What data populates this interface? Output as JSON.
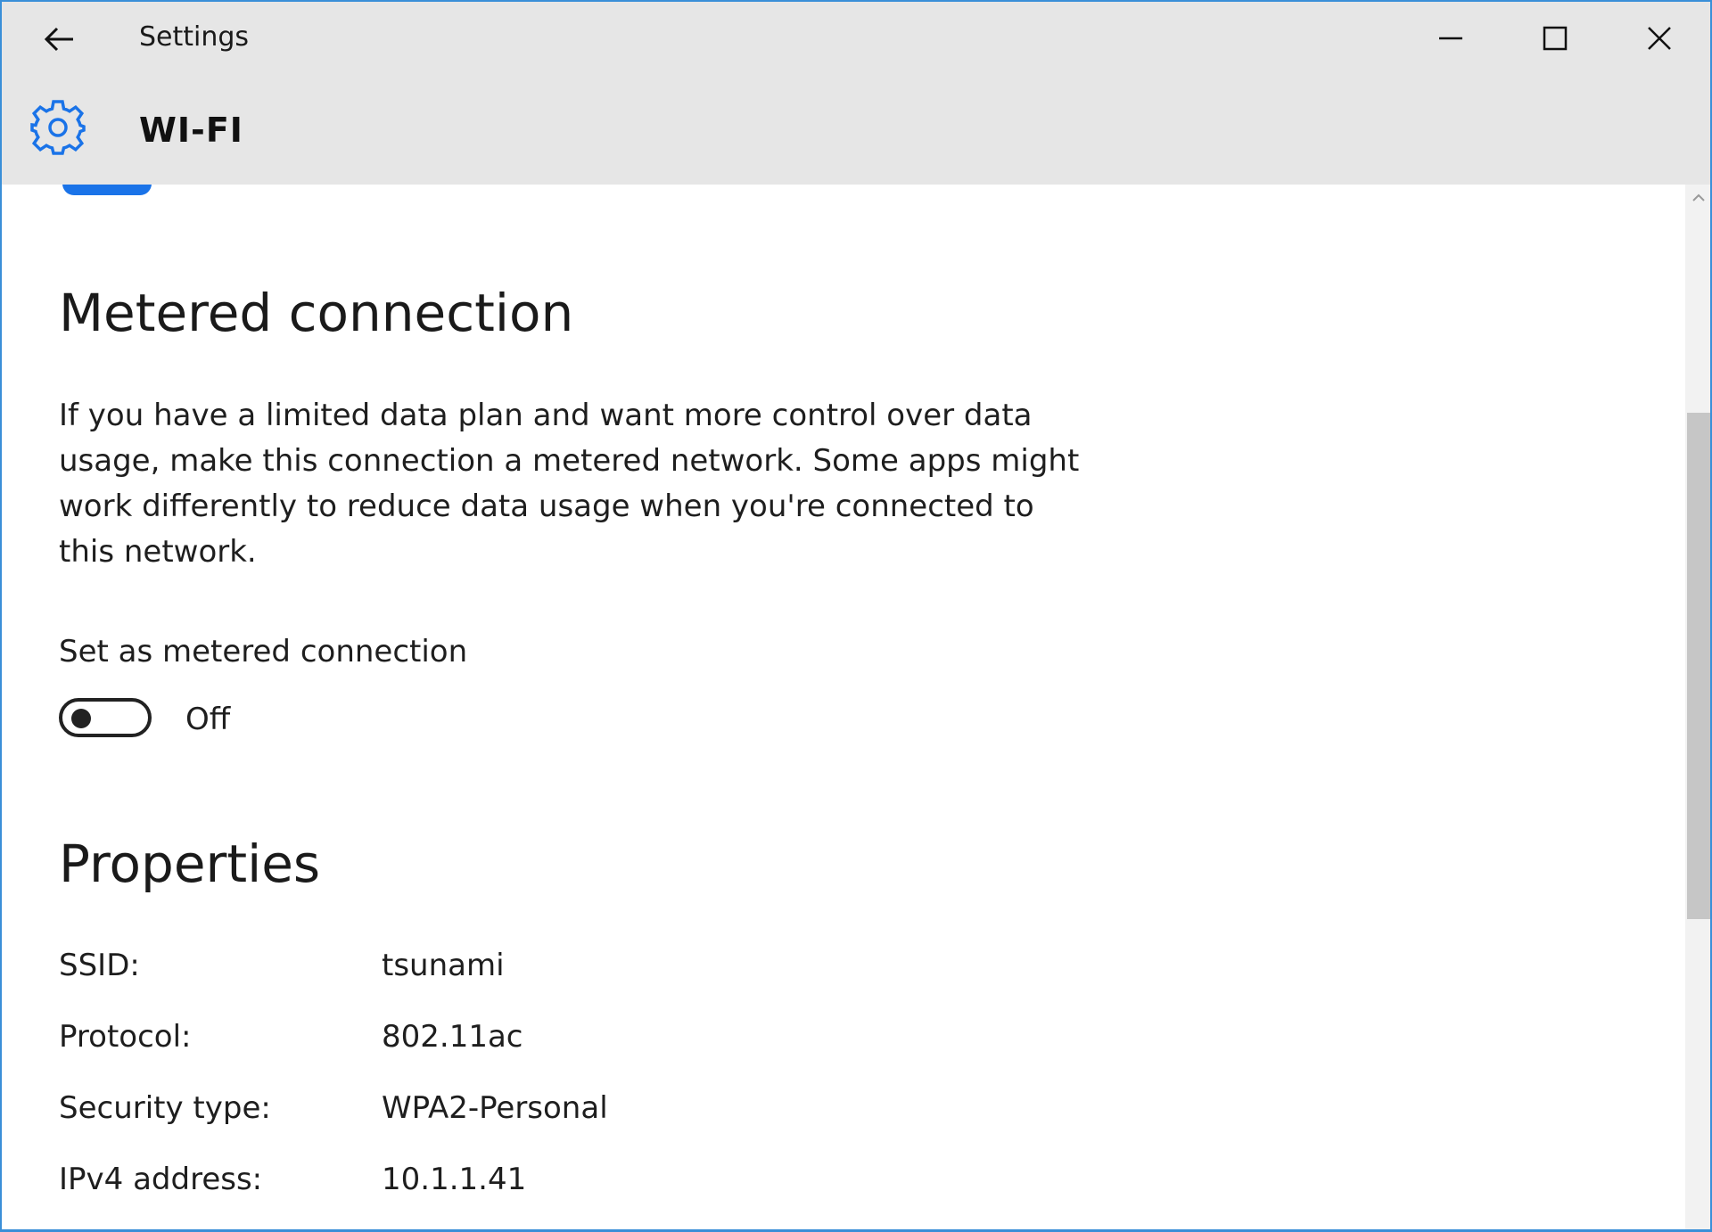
{
  "window": {
    "app_title": "Settings",
    "controls": {
      "minimize_icon": "minimize-icon",
      "maximize_icon": "maximize-icon",
      "close_icon": "close-icon"
    }
  },
  "header": {
    "icon": "gear-icon",
    "title": "WI-FI",
    "accent_color": "#1a73e8"
  },
  "metered": {
    "title": "Metered connection",
    "description": "If you have a limited data plan and want more control over data usage, make this connection a metered network. Some apps might work differently to reduce data usage when you're connected to this network.",
    "toggle_label": "Set as metered connection",
    "toggle_state": "Off",
    "toggle_on": false
  },
  "properties": {
    "title": "Properties",
    "rows": [
      {
        "key": "SSID:",
        "value": "tsunami"
      },
      {
        "key": "Protocol:",
        "value": "802.11ac"
      },
      {
        "key": "Security type:",
        "value": "WPA2-Personal"
      },
      {
        "key": "IPv4 address:",
        "value": "10.1.1.41"
      }
    ]
  }
}
